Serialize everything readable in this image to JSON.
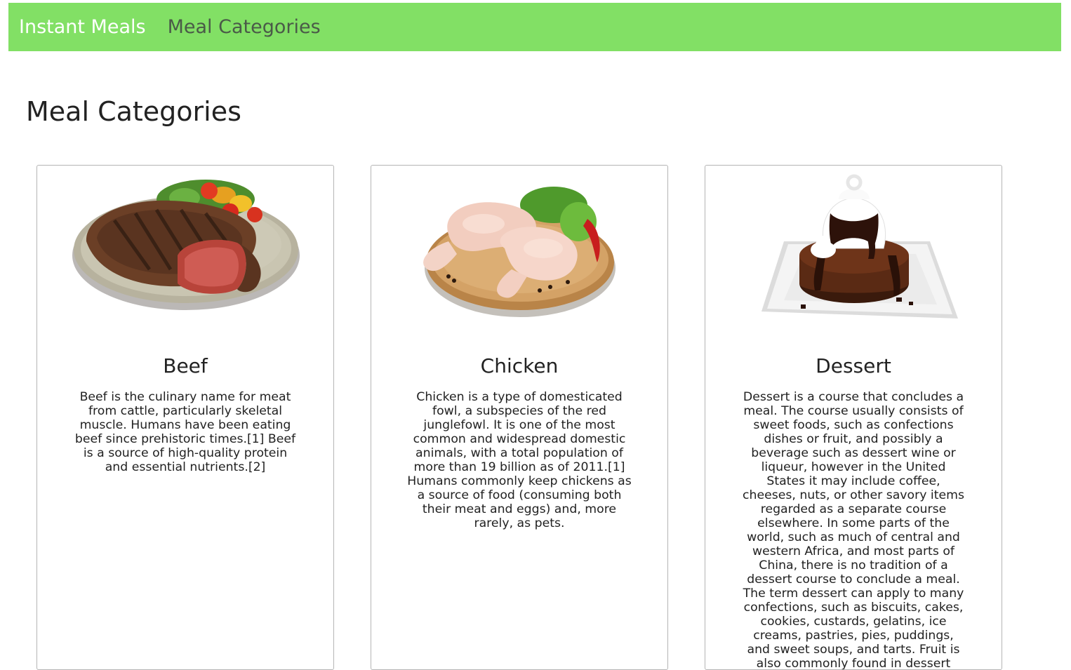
{
  "navbar": {
    "brand": "Instant Meals",
    "links": [
      "Meal Categories"
    ],
    "background_color": "#82e065"
  },
  "main": {
    "title": "Meal Categories"
  },
  "categories": [
    {
      "name": "Beef",
      "image_icon": "beef-steak-plate-icon",
      "description": "Beef is the culinary name for meat from cattle, particularly skeletal muscle. Humans have been eating beef since prehistoric times.[1] Beef is a source of high-quality protein and essential nutrients.[2]"
    },
    {
      "name": "Chicken",
      "image_icon": "chicken-legs-board-icon",
      "description": "Chicken is a type of domesticated fowl, a subspecies of the red junglefowl. It is one of the most common and widespread domestic animals, with a total population of more than 19 billion as of 2011.[1] Humans commonly keep chickens as a source of food (consuming both their meat and eggs) and, more rarely, as pets."
    },
    {
      "name": "Dessert",
      "image_icon": "chocolate-dessert-plate-icon",
      "description": "Dessert is a course that concludes a meal. The course usually consists of sweet foods, such as confections dishes or fruit, and possibly a beverage such as dessert wine or liqueur, however in the United States it may include coffee, cheeses, nuts, or other savory items regarded as a separate course elsewhere. In some parts of the world, such as much of central and western Africa, and most parts of China, there is no tradition of a dessert course to conclude a meal. The term dessert can apply to many confections, such as biscuits, cakes, cookies, custards, gelatins, ice creams, pastries, pies, puddings, and sweet soups, and tarts. Fruit is also commonly found in dessert courses because of its naturally occurring sweetness."
    }
  ]
}
